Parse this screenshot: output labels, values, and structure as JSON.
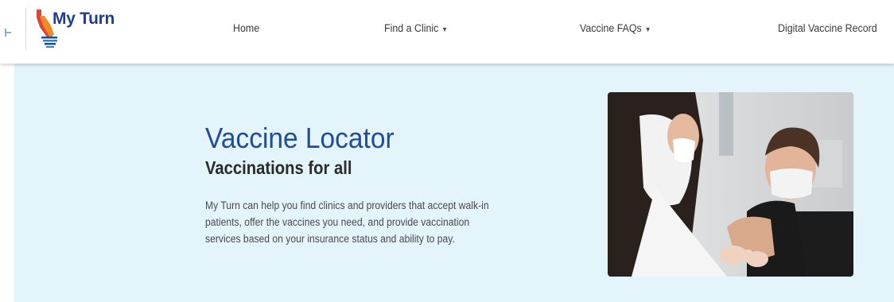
{
  "header": {
    "logo_text": "My Turn",
    "nav": [
      {
        "label": "Home"
      },
      {
        "label": "Find a Clinic",
        "caret": "▼"
      },
      {
        "label": "Vaccine FAQs",
        "caret": "▼"
      },
      {
        "label": "Digital Vaccine Record"
      }
    ]
  },
  "hero": {
    "title": "Vaccine Locator",
    "subtitle": "Vaccinations for all",
    "description": "My Turn can help you find clinics and providers that accept walk-in patients, offer the vaccines you need, and provide vaccination services based on your insurance status and ability to pay."
  },
  "colors": {
    "brand_blue": "#1f4c9b",
    "hero_background": "#e4f4fb",
    "logo_orange": "#f08a24",
    "logo_red": "#d9433a"
  }
}
